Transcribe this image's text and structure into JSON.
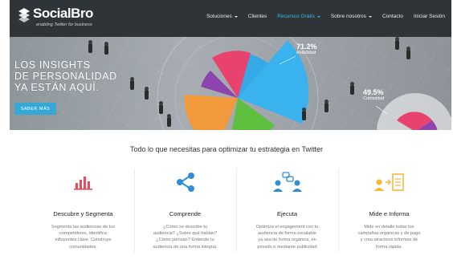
{
  "brand": {
    "name": "SocialBro",
    "tagline": "enabling Twitter for business"
  },
  "nav": {
    "items": [
      {
        "label": "Soluciones",
        "dropdown": true
      },
      {
        "label": "Clientes",
        "dropdown": false
      },
      {
        "label": "Recursos Gratis",
        "dropdown": true,
        "active": true
      },
      {
        "label": "Sobre nosotros",
        "dropdown": true
      },
      {
        "label": "Contacto",
        "dropdown": false
      },
      {
        "label": "Iniciar Sesión",
        "dropdown": false
      }
    ]
  },
  "hero": {
    "lines": [
      "LOS INSIGHTS",
      "DE PERSONALIDAD",
      "YA ESTÁN AQUÍ."
    ],
    "button_label": "SABER MÁS",
    "stats": [
      {
        "value": "71.2%",
        "label": "Afabilidad"
      },
      {
        "value": "49.5%",
        "label": "Curiosidad"
      }
    ]
  },
  "section": {
    "headline": "Todo lo que necesitas para optimizar tu estrategia en Twitter"
  },
  "features": [
    {
      "icon": "bar-chart-icon",
      "title": "Descubre y Segmenta",
      "desc": [
        "Segmenta las audiencias de tus",
        "competidores, identifica",
        "influyentes clave. Construye",
        "comunidades."
      ]
    },
    {
      "icon": "share-icon",
      "title": "Comprende",
      "desc": [
        "¿Cómo se describe tu",
        "audiencia? ¿Sobre qué hablan?",
        "¿Cómo piensan? Entiende tu",
        "audiencia de una forma integral."
      ]
    },
    {
      "icon": "people-chat-icon",
      "title": "Ejecuta",
      "desc": [
        "Optimiza el engagement con tu",
        "audiencia de forma escalable",
        "ya sea de forma orgánica, en",
        "privado o mediante publicidad"
      ]
    },
    {
      "icon": "report-icon",
      "title": "Mide e Informa",
      "desc": [
        "Mide en detalle todas tus",
        "campañas orgánicas y de pago",
        "y crea atractivos informes de",
        "forma rápida."
      ]
    }
  ],
  "colors": {
    "nav_bg": "#2f3439",
    "accent": "#35b8e8",
    "red": "#e74c5a",
    "blue": "#2e8fd6",
    "yellow": "#f2b632"
  }
}
